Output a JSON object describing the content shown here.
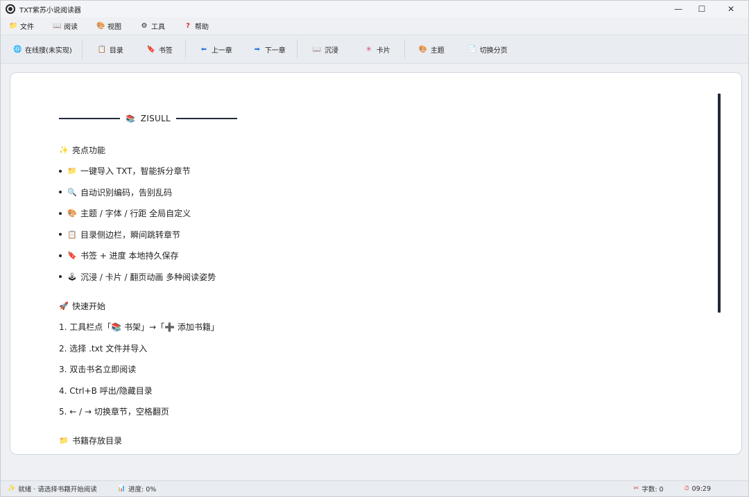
{
  "window": {
    "title": "TXT紫苏小说阅读器",
    "controls": {
      "minimize": "—",
      "maximize": "☐",
      "close": "✕"
    }
  },
  "menubar": [
    {
      "icon": "folder-icon",
      "glyph": "📁",
      "label": "文件"
    },
    {
      "icon": "book-icon",
      "glyph": "📖",
      "label": "阅读"
    },
    {
      "icon": "eye-icon",
      "glyph": "🎨",
      "label": "视图"
    },
    {
      "icon": "tools-icon",
      "glyph": "⚙",
      "label": "工具"
    },
    {
      "icon": "question-icon",
      "glyph": "?",
      "label": "帮助"
    }
  ],
  "toolbar": {
    "search": {
      "glyph": "🌐",
      "label": "在线搜(未实现)"
    },
    "toc": {
      "glyph": "📋",
      "label": "目录"
    },
    "bookmark": {
      "glyph": "🔖",
      "label": "书签"
    },
    "prev": {
      "glyph": "⬅",
      "label": "上一章"
    },
    "next": {
      "glyph": "➡",
      "label": "下一章"
    },
    "immersive": {
      "glyph": "📖",
      "label": "沉浸"
    },
    "card": {
      "glyph": "✳",
      "label": "卡片"
    },
    "theme": {
      "glyph": "🎨",
      "label": "主题"
    },
    "paging": {
      "glyph": "📄",
      "label": "切换分页"
    }
  },
  "content": {
    "heading": {
      "glyph": "📚",
      "text": "ZISULL"
    },
    "features_title": {
      "glyph": "✨",
      "text": "亮点功能"
    },
    "features": [
      {
        "glyph": "📁",
        "text": "一键导入 TXT，智能拆分章节"
      },
      {
        "glyph": "🔍",
        "text": "自动识别编码，告别乱码"
      },
      {
        "glyph": "🎨",
        "text": "主题 / 字体 / 行距 全局自定义"
      },
      {
        "glyph": "📋",
        "text": "目录侧边栏，瞬间跳转章节"
      },
      {
        "glyph": "🔖",
        "text": "书签 + 进度 本地持久保存"
      },
      {
        "glyph": "🕹",
        "text": "沉浸 / 卡片 / 翻页动画 多种阅读姿势"
      }
    ],
    "quickstart_title": {
      "glyph": "🚀",
      "text": "快速开始"
    },
    "steps": [
      "1. 工具栏点「📚 书架」→「➕ 添加书籍」",
      "2. 选择 .txt 文件并导入",
      "3. 双击书名立即阅读",
      "4. Ctrl+B 呼出/隐藏目录",
      "5. ← / → 切换章节，空格翻页"
    ],
    "dir_title": {
      "glyph": "📁",
      "text": "书籍存放目录"
    }
  },
  "statusbar": {
    "status": {
      "glyph": "✨",
      "text": "就绪 · 请选择书籍开始阅读"
    },
    "progress": {
      "glyph": "📊",
      "text": "进度: 0%"
    },
    "words": {
      "glyph": "✂",
      "text": "字数: 0"
    },
    "time": {
      "glyph": "⏱",
      "text": "09:29"
    }
  },
  "colors": {
    "accent_line": "#23283a",
    "panel_bg": "#ffffff",
    "chrome_bg": "#e9ecf1"
  }
}
